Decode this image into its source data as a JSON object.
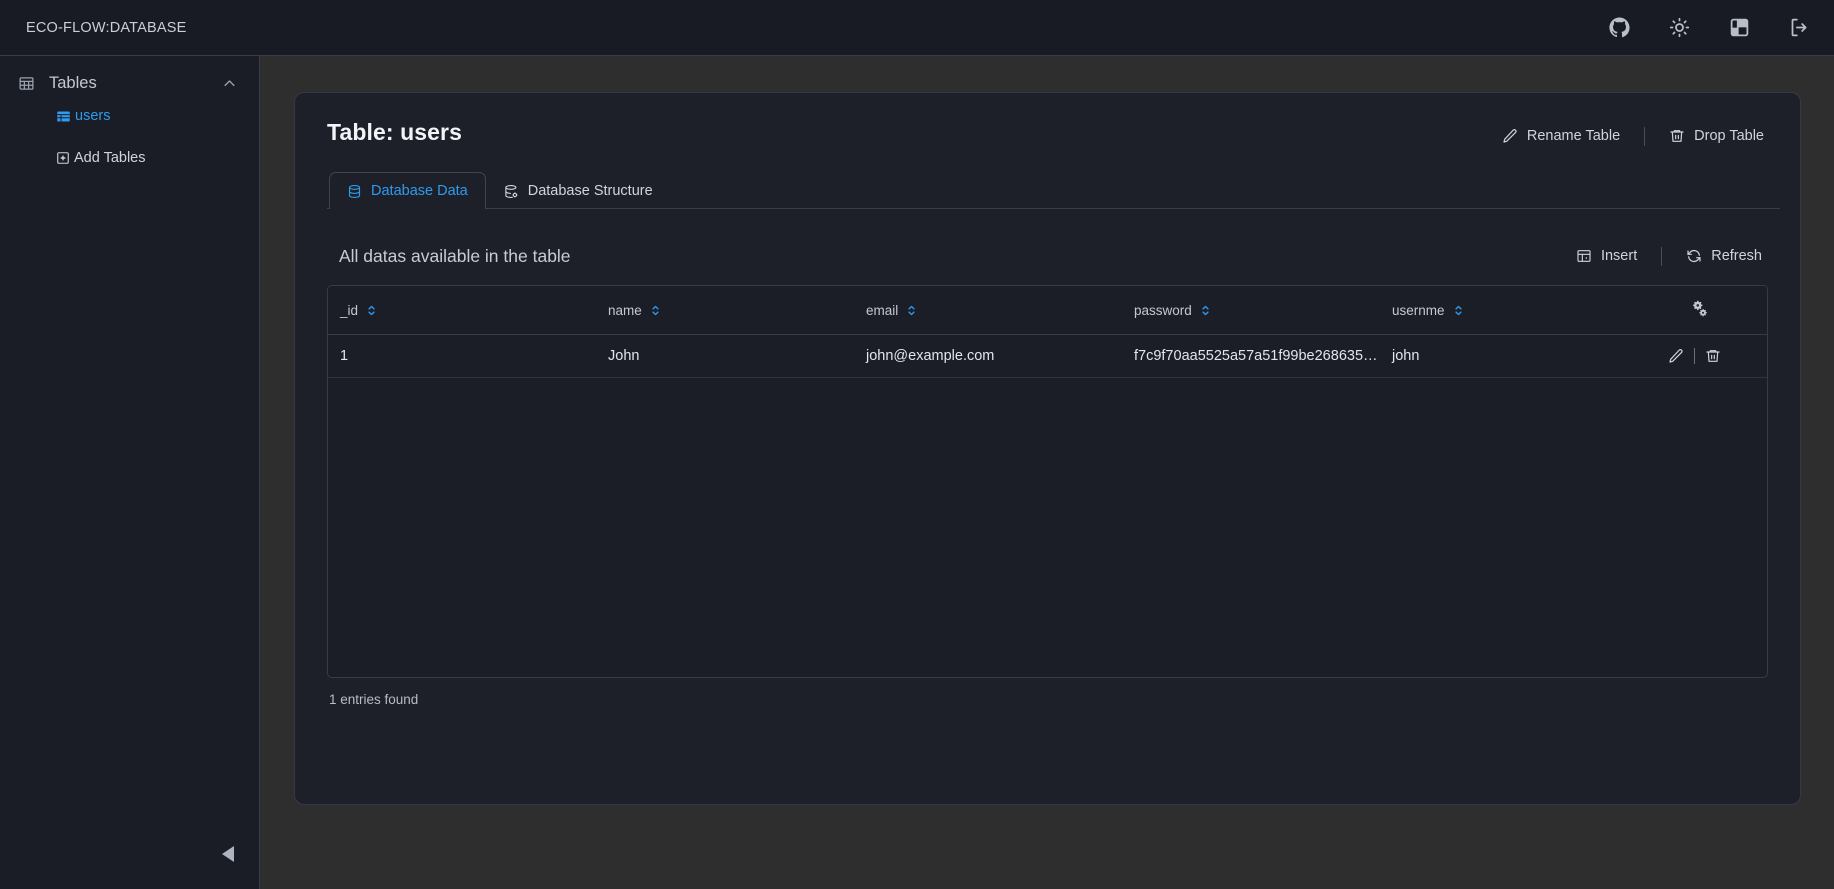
{
  "topbar": {
    "title": "ECO-FLOW:DATABASE",
    "icons": [
      {
        "name": "github-icon",
        "label": "GitHub"
      },
      {
        "name": "sun-icon",
        "label": "Toggle theme"
      },
      {
        "name": "panel-layout-icon",
        "label": "Toggle panel"
      },
      {
        "name": "logout-icon",
        "label": "Log out"
      }
    ]
  },
  "sidebar": {
    "section": {
      "label": "Tables",
      "icon": "table-icon",
      "chevron": "chevron-up-icon"
    },
    "items": [
      {
        "label": "users",
        "icon": "table-small-icon",
        "active": true
      },
      {
        "label": "Add Tables",
        "icon": "plus-square-icon",
        "active": false
      }
    ],
    "collapse": {
      "label": "Collapse sidebar",
      "icon": "triangle-left-icon"
    }
  },
  "main": {
    "title": "Table: users",
    "head_actions": [
      {
        "label": "Rename Table",
        "icon": "pencil-icon"
      },
      {
        "label": "Drop Table",
        "icon": "trash-icon"
      }
    ],
    "tabs": [
      {
        "label": "Database Data",
        "icon": "database-icon",
        "active": true
      },
      {
        "label": "Database Structure",
        "icon": "database-cog-icon",
        "active": false
      }
    ],
    "section_title": "All datas available in the table",
    "section_actions": [
      {
        "label": "Insert",
        "icon": "insert-table-icon"
      },
      {
        "label": "Refresh",
        "icon": "refresh-icon"
      }
    ],
    "table": {
      "columns": [
        {
          "label": "_id",
          "sortable": true
        },
        {
          "label": "name",
          "sortable": true
        },
        {
          "label": "email",
          "sortable": true
        },
        {
          "label": "password",
          "sortable": true
        },
        {
          "label": "usernme",
          "sortable": true
        }
      ],
      "settings_icon": "gears-icon",
      "rows": [
        {
          "_id": "1",
          "name": "John",
          "email": "john@example.com",
          "password": "f7c9f70aa5525a57a51f99be268635f3...",
          "usernme": "john",
          "actions": [
            {
              "label": "Edit row",
              "icon": "pencil-icon"
            },
            {
              "label": "Delete row",
              "icon": "trash-icon"
            }
          ]
        }
      ]
    },
    "entries_text": "1 entries found"
  },
  "colors": {
    "accent": "#2f9bec",
    "page_bg": "#2e2e2e",
    "panel_bg": "#1e2029",
    "sidebar_bg": "#1a1d26",
    "topbar_bg": "#181b23",
    "border": "#383b45",
    "text": "#d7dae0"
  }
}
